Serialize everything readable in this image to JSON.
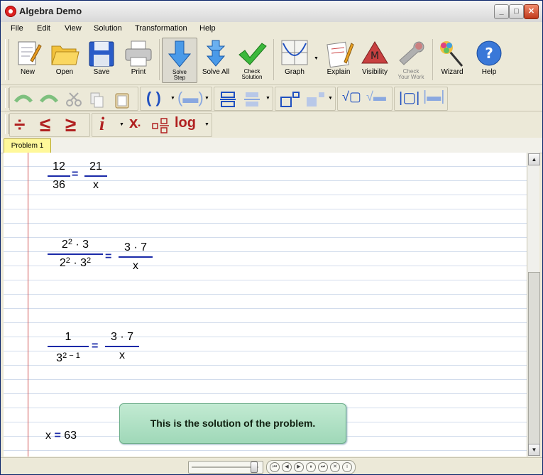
{
  "window": {
    "title": "Algebra Demo"
  },
  "menu": [
    "File",
    "Edit",
    "View",
    "Solution",
    "Transformation",
    "Help"
  ],
  "toolbar": {
    "new": "New",
    "open": "Open",
    "save": "Save",
    "print": "Print",
    "solve_step_line1": "Solve",
    "solve_step_line2": "Step",
    "solve_all": "Solve All",
    "check_solution_line1": "Check",
    "check_solution_line2": "Solution",
    "graph": "Graph",
    "explain": "Explain",
    "visibility": "Visibility",
    "check_work_line1": "Check",
    "check_work_line2": "Your Work",
    "wizard": "Wizard",
    "help": "Help"
  },
  "format_toolbar": {
    "log_label": "log",
    "italic_label": "i",
    "var_label": "x"
  },
  "tabs": [
    "Problem 1"
  ],
  "steps": {
    "s1": {
      "lnum": "12",
      "lden": "36",
      "rnum": "21",
      "rden": "x"
    },
    "s2": {
      "lnum_base": "2",
      "lnum_exp": "2",
      "lnum_rest": "· 3",
      "lden_base1": "2",
      "lden_exp1": "2",
      "lden_mid": "· 3",
      "lden_exp2": "2",
      "rnum": "3  · 7",
      "rden": "x"
    },
    "s3": {
      "lnum": "1",
      "lden_base": "3",
      "lden_exp": "2 − 1",
      "rnum": "3  · 7",
      "rden": "x"
    },
    "answer": {
      "var": "x",
      "eq": "=",
      "value": "63"
    },
    "eq_sign": "="
  },
  "message": "This is the solution of the problem.",
  "colors": {
    "accent": "#1a2aa8",
    "margin": "#d05050",
    "message_bg": "#b0e0c4"
  }
}
